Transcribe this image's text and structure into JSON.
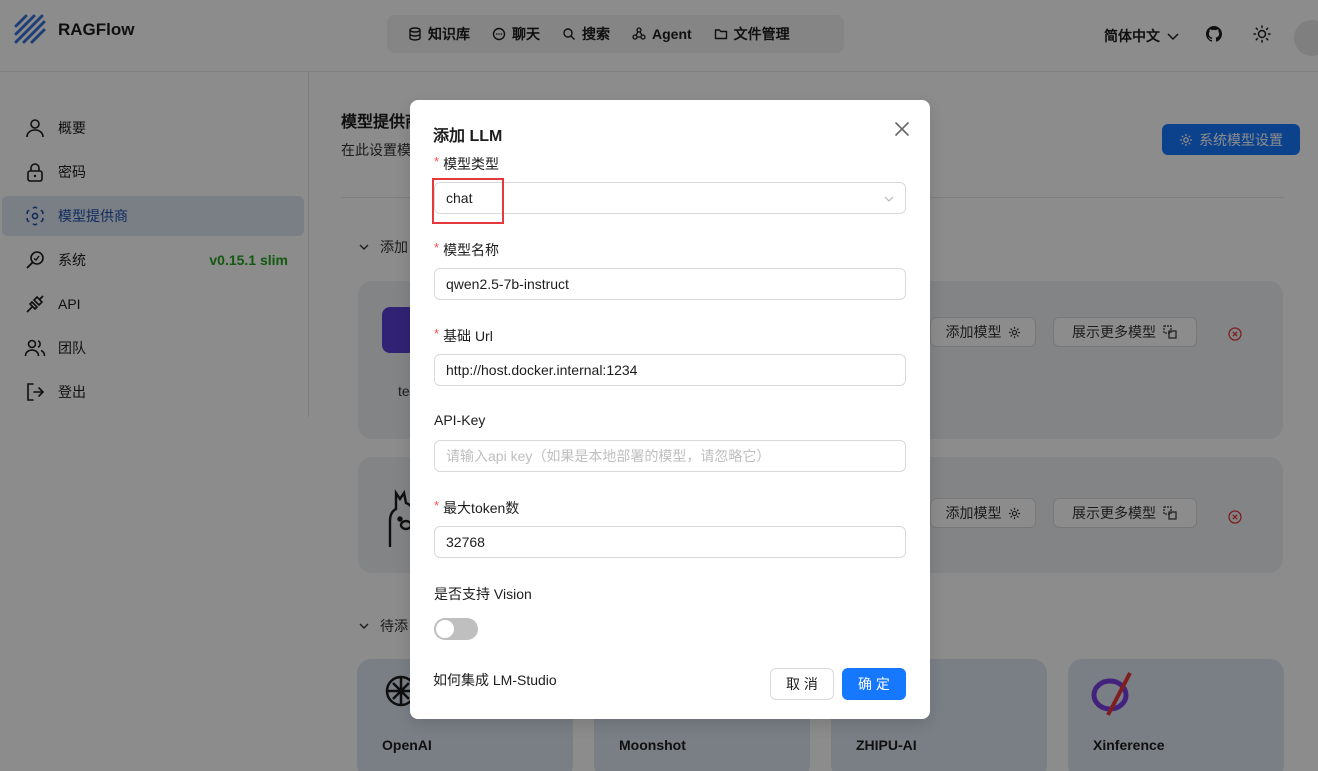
{
  "header": {
    "app_name": "RAGFlow",
    "nav": [
      {
        "label": "知识库",
        "icon": "database-icon"
      },
      {
        "label": "聊天",
        "icon": "chat-icon"
      },
      {
        "label": "搜索",
        "icon": "search-icon"
      },
      {
        "label": "Agent",
        "icon": "agent-icon"
      },
      {
        "label": "文件管理",
        "icon": "folder-icon"
      }
    ],
    "language": "简体中文"
  },
  "sidebar": {
    "items": [
      {
        "label": "概要",
        "icon": "user-icon"
      },
      {
        "label": "密码",
        "icon": "lock-icon"
      },
      {
        "label": "模型提供商",
        "icon": "model-icon",
        "active": true
      },
      {
        "label": "系统",
        "icon": "system-icon",
        "badge": "v0.15.1 slim"
      },
      {
        "label": "API",
        "icon": "plug-icon"
      },
      {
        "label": "团队",
        "icon": "team-icon"
      },
      {
        "label": "登出",
        "icon": "logout-icon"
      }
    ]
  },
  "main": {
    "title": "模型提供商",
    "subtitle": "在此设置模型",
    "system_model_button": "系统模型设置",
    "added_section": "添加",
    "pending_section": "待添",
    "card1_name": "te",
    "add_model_label": "添加模型",
    "show_more_label": "展示更多模型",
    "pending_providers": [
      "OpenAI",
      "Moonshot",
      "ZHIPU-AI",
      "Xinference"
    ]
  },
  "modal": {
    "title": "添加 LLM",
    "fields": {
      "model_type": {
        "label": "模型类型",
        "value": "chat"
      },
      "model_name": {
        "label": "模型名称",
        "value": "qwen2.5-7b-instruct"
      },
      "base_url": {
        "label": "基础 Url",
        "value": "http://host.docker.internal:1234"
      },
      "api_key": {
        "label": "API-Key",
        "placeholder": "请输入api key（如果是本地部署的模型，请忽略它）"
      },
      "max_tokens": {
        "label": "最大token数",
        "value": "32768"
      },
      "vision": {
        "label": "是否支持 Vision",
        "enabled": false
      }
    },
    "help_link": "如何集成 LM-Studio",
    "cancel_label": "取 消",
    "ok_label": "确 定"
  },
  "colors": {
    "primary": "#1677ff",
    "required_star": "#ff4d4f",
    "highlight_box": "#e5383b",
    "version_green": "#26a21e"
  }
}
